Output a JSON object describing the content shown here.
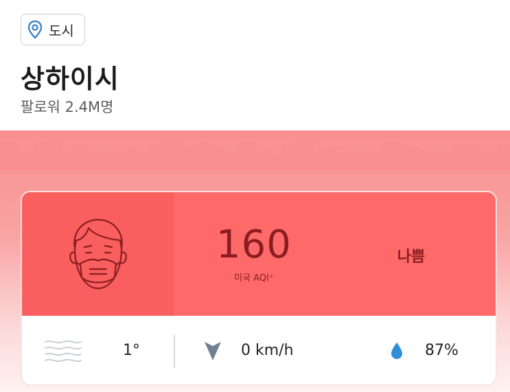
{
  "location_tag": {
    "label": "도시",
    "icon": "location-pin-icon"
  },
  "city": {
    "name": "상하이시",
    "followers": "팔로워 2.4M명"
  },
  "aqi": {
    "value": "160",
    "label": "미국 AQI⁺",
    "status": "나쁨",
    "face_icon": "mask-face-icon",
    "colors": {
      "panel": "#fe6a6a",
      "face_panel": "#f85f5e",
      "text": "#8b1d22"
    }
  },
  "weather": {
    "temperature": "1°",
    "wind": "0 km/h",
    "humidity": "87%",
    "icons": [
      "haze-icon",
      "wind-direction-icon",
      "humidity-drop-icon"
    ]
  }
}
